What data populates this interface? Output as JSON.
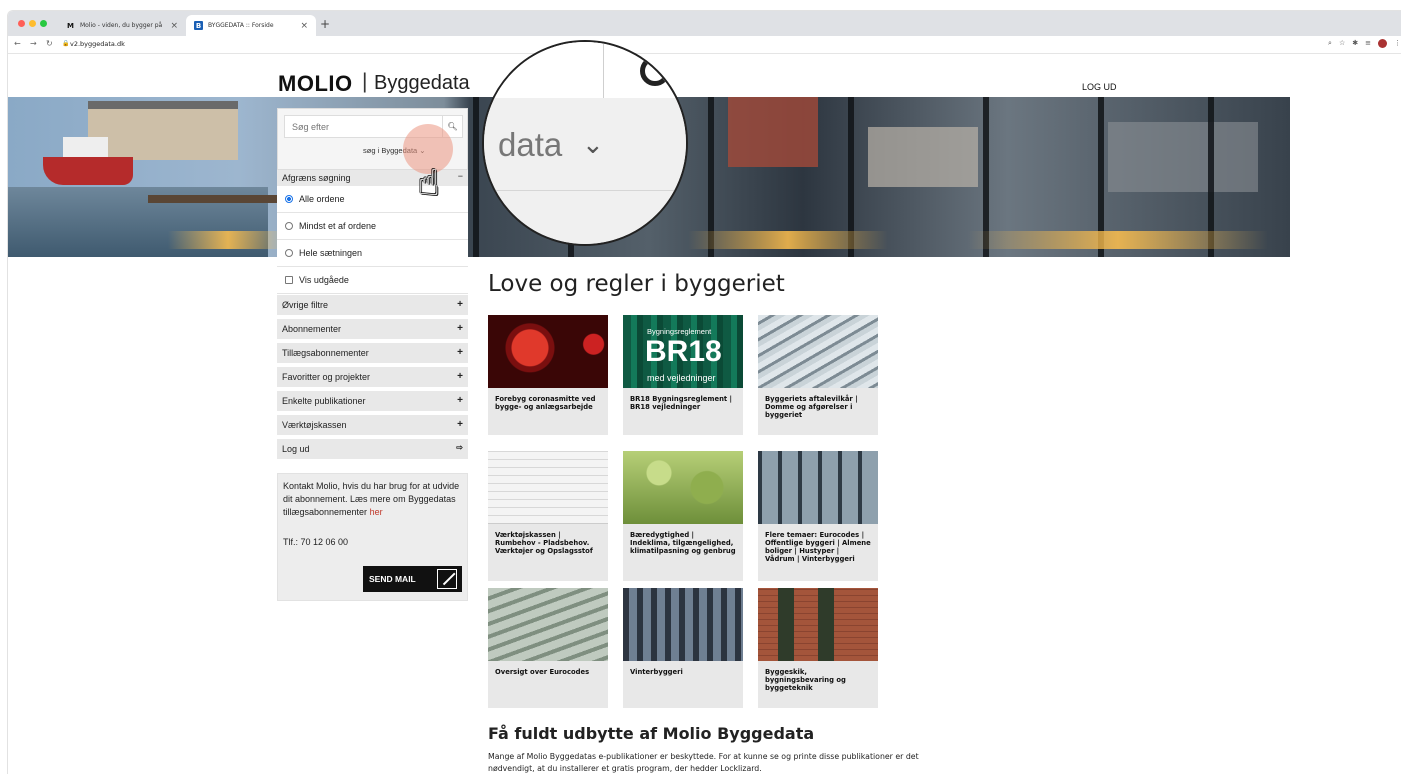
{
  "browser": {
    "tabs": [
      {
        "label": "Molio - viden, du bygger på",
        "favicon": "M"
      },
      {
        "label": "BYGGEDATA :: Forside",
        "favicon": "B"
      }
    ],
    "url": "v2.byggedata.dk"
  },
  "header": {
    "logo_brand": "MOLIO",
    "logo_separator": "|",
    "logo_product": "Byggedata",
    "logout": "LOG UD"
  },
  "search": {
    "placeholder": "Søg efter",
    "scope": "søg i Byggedata"
  },
  "filter": {
    "title": "Afgræns søgning",
    "collapse": "−",
    "options": [
      "Alle ordene",
      "Mindst et af ordene",
      "Hele sætningen"
    ],
    "checkbox": "Vis udgåede"
  },
  "accordion": [
    {
      "label": "Øvrige filtre",
      "icon": "+"
    },
    {
      "label": "Abonnementer",
      "icon": "+"
    },
    {
      "label": "Tillægsabonnementer",
      "icon": "+"
    },
    {
      "label": "Favoritter og projekter",
      "icon": "+"
    },
    {
      "label": "Enkelte publikationer",
      "icon": "+"
    },
    {
      "label": "Værktøjskassen",
      "icon": "+"
    },
    {
      "label": "Log ud",
      "icon": "⇨"
    }
  ],
  "contact": {
    "text": "Kontakt Molio, hvis du har brug for at udvide dit abonnement. Læs mere om Byggedatas tillægsabonnementer ",
    "link": "her",
    "phone": "Tlf.: 70 12 06 00",
    "button": "SEND MAIL"
  },
  "main": {
    "title": "Love og regler i byggeriet",
    "cards": [
      {
        "caption": "Forebyg coronasmitte ved bygge- og anlægsarbejde"
      },
      {
        "caption": "BR18 Bygningsreglement | BR18 vejledninger",
        "overlay_small": "Bygningsreglement",
        "overlay_big": "BR18",
        "overlay_sub": "med vejledninger"
      },
      {
        "caption": "Byggeriets aftalevilkår | Domme og afgørelser i byggeriet"
      },
      {
        "caption": "Værktøjskassen | Rumbehov - Pladsbehov. Værktøjer og Opslagsstof"
      },
      {
        "caption": "Bæredygtighed | Indeklima, tilgængelighed, klimatilpasning og genbrug"
      },
      {
        "caption": "Flere temaer: Eurocodes | Offentlige byggeri | Almene boliger | Hustyper | Vådrum | Vinterbyggeri"
      },
      {
        "caption": "Oversigt over Eurocodes"
      },
      {
        "caption": "Vinterbyggeri"
      },
      {
        "caption": "Byggeskik, bygningsbevaring og byggeteknik"
      }
    ],
    "subtitle": "Få fuldt udbytte af Molio Byggedata",
    "paragraph": "Mange af Molio Byggedatas e-publikationer er beskyttede. For at kunne se og printe disse publikationer er det nødvendigt, at du installerer et gratis program, der hedder Locklizard."
  },
  "magnifier": {
    "text": "data"
  },
  "colors": {
    "accent_link": "#c0392b",
    "sidebar_bg": "#e8e8e8",
    "button_bg": "#111111"
  }
}
